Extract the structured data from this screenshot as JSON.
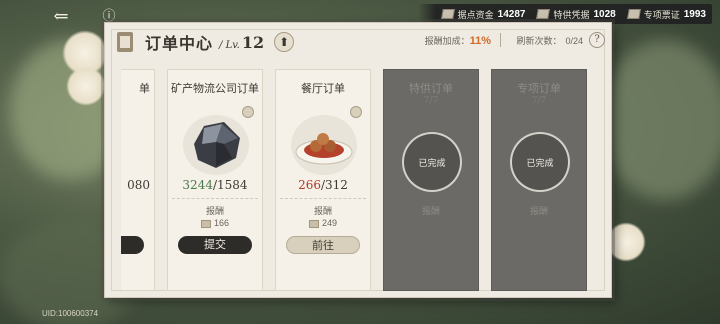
{
  "header": {
    "back_icon": "back-arrow-icon",
    "info_icon": "info-icon",
    "title": "订单中心",
    "lv_prefix": "/ Lv.",
    "lv_value": "12",
    "bonus_label": "报酬加成：",
    "bonus_value": "11%",
    "refresh_label": "刷新次数：",
    "refresh_value": "0/24"
  },
  "resources": [
    {
      "label": "据点资金",
      "value": "14287",
      "icon": "funds-icon"
    },
    {
      "label": "特供凭据",
      "value": "1028",
      "icon": "voucher-icon"
    },
    {
      "label": "专项票证",
      "value": "1993",
      "icon": "ticket-icon"
    }
  ],
  "cards": [
    {
      "name": "单",
      "count_prefix": "",
      "count_cur": "",
      "count_total": "080",
      "reward_label": "",
      "reward_value": "",
      "button": ""
    },
    {
      "name": "矿产物流公司订单",
      "count_cur": "3244",
      "count_total": "/1584",
      "reward_label": "报酬",
      "reward_value": "166",
      "button": "提交",
      "image": "ore-icon"
    },
    {
      "name": "餐厅订单",
      "count_cur": "266",
      "count_total": "/312",
      "reward_label": "报酬",
      "reward_value": "249",
      "button": "前往",
      "image": "dish-icon"
    },
    {
      "name": "特供订单",
      "ghost": "7/7",
      "stamp": "已完成",
      "reward_label": "报酬",
      "reward_value": "",
      "image": "dish-icon"
    },
    {
      "name": "专项订单",
      "ghost": "7/7",
      "stamp": "已完成",
      "reward_label": "报酬",
      "reward_value": "",
      "image": "ore-icon"
    }
  ],
  "uid": "UID:100600374",
  "colors": {
    "accent": "#d06a2a",
    "count_green": "#4a7a4a",
    "count_red": "#b23a2a"
  }
}
